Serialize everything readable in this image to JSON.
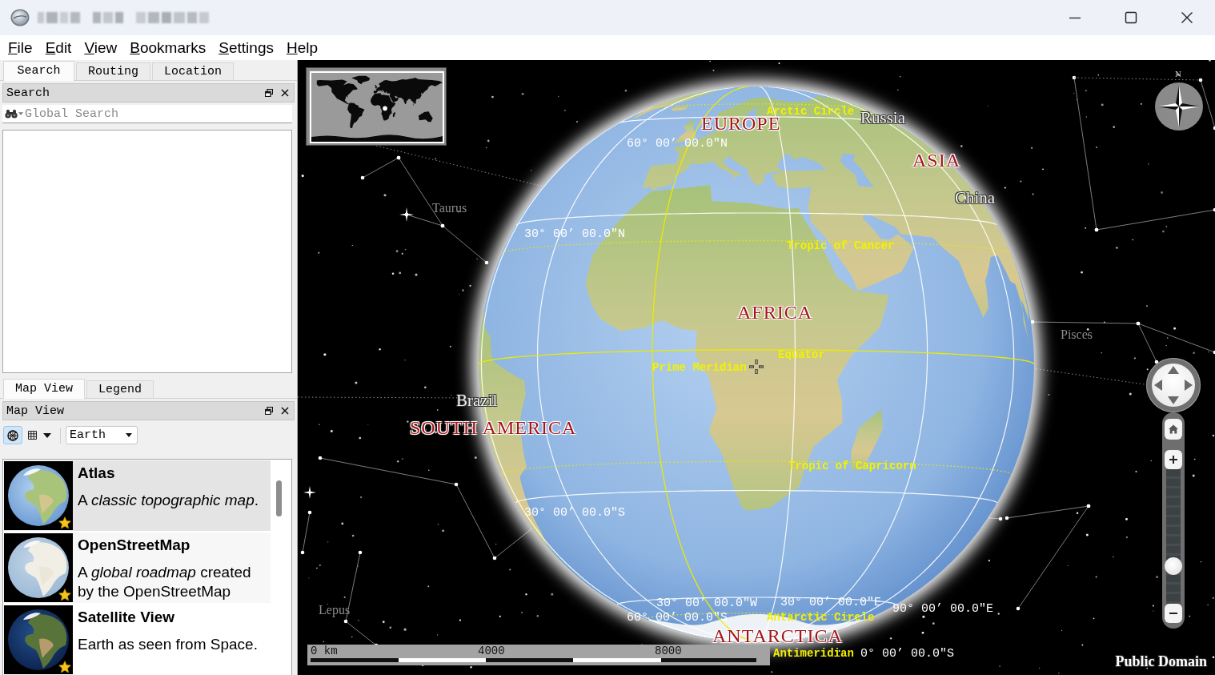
{
  "menu": [
    "File",
    "Edit",
    "View",
    "Bookmarks",
    "Settings",
    "Help"
  ],
  "panel_tabs": [
    {
      "label": "Search",
      "selected": true
    },
    {
      "label": "Routing",
      "selected": false
    },
    {
      "label": "Location",
      "selected": false
    }
  ],
  "search_dock": {
    "title": "Search",
    "placeholder": "Global Search"
  },
  "lower_tabs": [
    {
      "label": "Map View",
      "selected": true
    },
    {
      "label": "Legend",
      "selected": false
    }
  ],
  "map_view_dock": {
    "title": "Map View",
    "projection_buttons": [
      {
        "kind": "globe",
        "selected": true
      },
      {
        "kind": "grid",
        "selected": false
      }
    ],
    "celestial_body": "Earth",
    "map_themes": [
      {
        "kind": "atlas",
        "title": "Atlas",
        "description": "A *classic topographic map*.",
        "favorite": true,
        "selected": true
      },
      {
        "kind": "openstreetmap",
        "title": "OpenStreetMap",
        "description": "A *global roadmap* created by the OpenStreetMap",
        "favorite": true,
        "selected": false
      },
      {
        "kind": "satellite",
        "title": "Satellite View",
        "description": "Earth as seen from Space.",
        "favorite": true,
        "selected": false
      }
    ]
  },
  "map": {
    "labels": [
      {
        "text": "Arctic Circle",
        "kind": "line"
      },
      {
        "text": "Russia",
        "kind": "country"
      },
      {
        "text": "EUROPE",
        "kind": "continent"
      },
      {
        "text": "60° 00’ 00.0″N",
        "kind": "coordinate"
      },
      {
        "text": "ASIA",
        "kind": "continent"
      },
      {
        "text": "China",
        "kind": "country"
      },
      {
        "text": "Taurus",
        "kind": "constellation"
      },
      {
        "text": "30° 00’ 00.0″N",
        "kind": "coordinate"
      },
      {
        "text": "Tropic of Cancer",
        "kind": "line"
      },
      {
        "text": "AFRICA",
        "kind": "continent"
      },
      {
        "text": "Pisces",
        "kind": "constellation"
      },
      {
        "text": "Equator",
        "kind": "line"
      },
      {
        "text": "Prime Meridian",
        "kind": "line"
      },
      {
        "text": "Brazil",
        "kind": "country"
      },
      {
        "text": "SOUTH AMERICA",
        "kind": "continent"
      },
      {
        "text": "Tropic of Capricorn",
        "kind": "line"
      },
      {
        "text": "30° 00’ 00.0″S",
        "kind": "coordinate"
      },
      {
        "text": "Lepus",
        "kind": "constellation"
      },
      {
        "text": "30° 00’ 00.0″W",
        "kind": "coordinate"
      },
      {
        "text": "30° 00’ 00.0″E",
        "kind": "coordinate"
      },
      {
        "text": "90° 00’ 00.0″E",
        "kind": "coordinate"
      },
      {
        "text": "60° 00’ 00.0″S",
        "kind": "coordinate"
      },
      {
        "text": "Antarctic Circle",
        "kind": "line"
      },
      {
        "text": "ANTARCTICA",
        "kind": "continent"
      },
      {
        "text": "Antimeridian",
        "kind": "line"
      },
      {
        "text": "0° 00’ 00.0″S",
        "kind": "coordinate"
      }
    ],
    "compass": {
      "label": "N"
    },
    "zoom_slider": {
      "level": 0.25
    },
    "scale_bar": {
      "ticks": [
        "0 km",
        "4000",
        "8000"
      ]
    },
    "attribution": "Public Domain"
  }
}
